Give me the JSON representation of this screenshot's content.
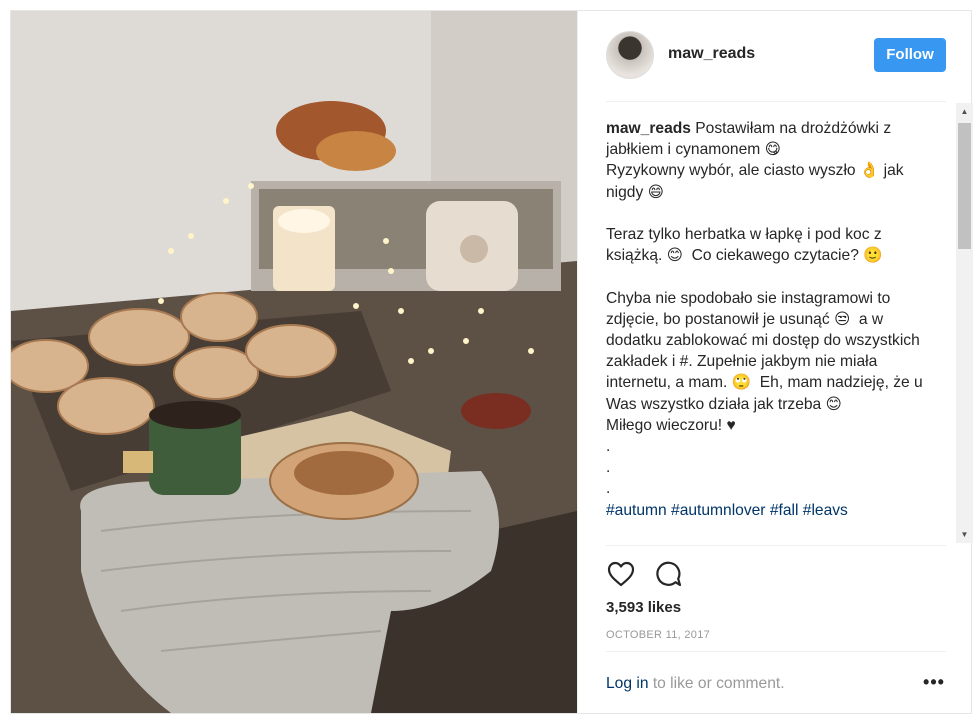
{
  "post": {
    "photo_alt": "",
    "header": {
      "username": "maw_reads",
      "follow_label": "Follow"
    },
    "caption": {
      "author": "maw_reads",
      "text": " Postawiłam na drożdżówki z jabłkiem i cynamonem 😋\nRyzykowny wybór, ale ciasto wyszło 👌 jak nigdy 😄\n\nTeraz tylko herbatka w łapkę i pod koc z książką. 😊  Co ciekawego czytacie? 🙂\n\nChyba nie spodobało sie instagramowi to zdjęcie, bo postanowił je usunąć 😒  a w dodatku zablokować mi dostęp do wszystkich zakładek i #. Zupełnie jakbym nie miała internetu, a mam. 🙄  Eh, mam nadzieję, że u Was wszystko działa jak trzeba 😊\nMiłego wieczoru! ♥\n.\n.\n.\n",
      "hashtags": "#autumn #autumnlover #fall #leavs"
    },
    "likes": "3,593 likes",
    "date": "OCTOBER 11, 2017",
    "login_link": "Log in",
    "login_suffix": " to like or comment.",
    "more_label": "•••",
    "icons": {
      "like": "heart-icon",
      "comment": "comment-icon",
      "more": "more-icon"
    },
    "colors": {
      "accent": "#3897f0",
      "link": "#003569",
      "muted": "#999999",
      "text": "#262626"
    }
  }
}
